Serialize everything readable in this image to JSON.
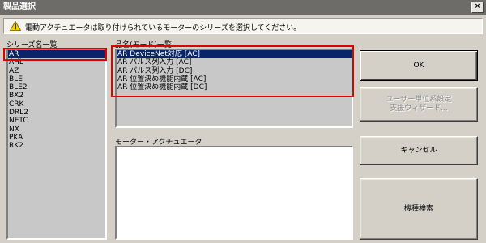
{
  "window": {
    "title": "製品選択",
    "close_label": "×"
  },
  "info": {
    "icon": "warning-icon",
    "message": "電動アクチュエータは取り付けられているモーターのシリーズを選択してください。"
  },
  "series": {
    "header": "シリーズ名一覧",
    "items": [
      "AR",
      "AHL",
      "AZ",
      "BLE",
      "BLE2",
      "BX2",
      "CRK",
      "DRL2",
      "NETC",
      "NX",
      "PKA",
      "RK2"
    ],
    "selected": "AR"
  },
  "products": {
    "header": "品名(モード)一覧",
    "items": [
      "AR DeviceNet対応 [AC]",
      "AR パルス列入力 [AC]",
      "AR パルス列入力 [DC]",
      "AR 位置決め機能内蔵 [AC]",
      "AR 位置決め機能内蔵 [DC]"
    ],
    "selected": "AR DeviceNet対応 [AC]"
  },
  "motor": {
    "header": "モーター・アクチュエータ"
  },
  "buttons": {
    "ok": "OK",
    "unit_wizard": "ユーザー単位系設定\n支援ウィザード...",
    "cancel": "キャンセル",
    "model_search": "機種検索"
  },
  "colors": {
    "highlight_box": "#e00000",
    "selection": "#0a246a"
  }
}
